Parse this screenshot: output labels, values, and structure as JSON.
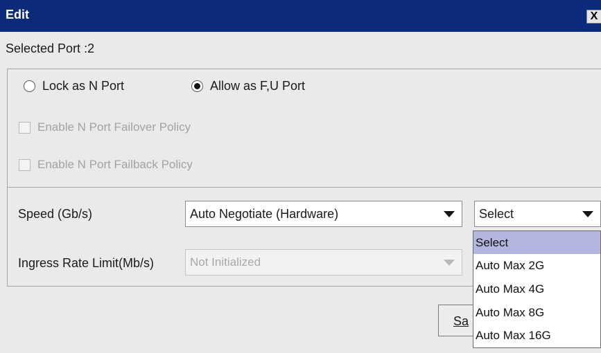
{
  "window": {
    "title": "Edit",
    "close_label": "X"
  },
  "selected_port_label": "Selected Port :2",
  "radios": [
    {
      "label": "Lock as N Port",
      "checked": false
    },
    {
      "label": "Allow as F,U Port",
      "checked": true
    }
  ],
  "checkboxes": [
    {
      "label": "Enable N Port Failover Policy",
      "enabled": false,
      "checked": false
    },
    {
      "label": "Enable N Port Failback Policy",
      "enabled": false,
      "checked": false
    }
  ],
  "speed": {
    "label": "Speed (Gb/s)",
    "mode_value": "Auto Negotiate (Hardware)",
    "max_value": "Select",
    "options": [
      "Select",
      "Auto Max 2G",
      "Auto Max 4G",
      "Auto Max 8G",
      "Auto Max 16G"
    ],
    "highlighted_option": "Select"
  },
  "ingress": {
    "label": "Ingress Rate Limit(Mb/s)",
    "value": "Not Initialized",
    "enabled": false
  },
  "buttons": {
    "save_partial": "Sa"
  },
  "colors": {
    "titlebar": "#0b2a7a",
    "background": "#eaeaea",
    "highlight": "#b4b6e0"
  }
}
